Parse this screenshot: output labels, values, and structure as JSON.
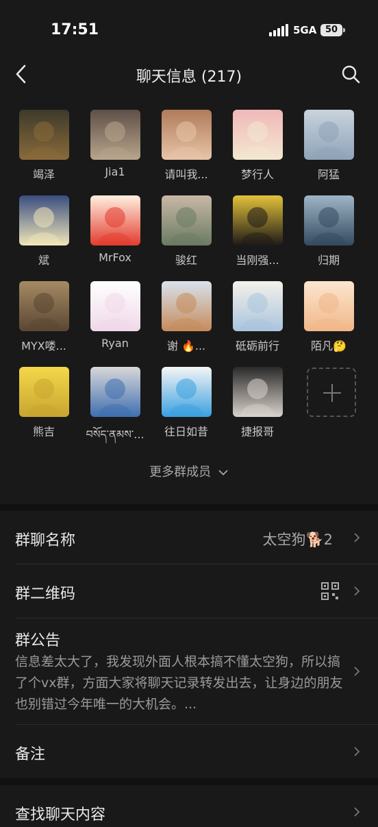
{
  "status_bar": {
    "time": "17:51",
    "network": "5GA",
    "battery": "50"
  },
  "nav": {
    "title": "聊天信息 (217)"
  },
  "members": [
    {
      "name": "竭泽"
    },
    {
      "name": "Jia1"
    },
    {
      "name": "请叫我..."
    },
    {
      "name": "梦行人"
    },
    {
      "name": "阿猛"
    },
    {
      "name": "斌"
    },
    {
      "name": "MrFox"
    },
    {
      "name": "骏红"
    },
    {
      "name": "当刚强..."
    },
    {
      "name": "归期"
    },
    {
      "name": "MYX喽..."
    },
    {
      "name": "Ryan"
    },
    {
      "name": "谢 🔥..."
    },
    {
      "name": "砥砺前行"
    },
    {
      "name": "陌凡🤔"
    },
    {
      "name": "熊吉"
    },
    {
      "name": "བསོད་ནམས་..."
    },
    {
      "name": "往日如昔"
    },
    {
      "name": "捷报哥"
    }
  ],
  "more_members": "更多群成员",
  "settings": {
    "group_name": {
      "label": "群聊名称",
      "value": "太空狗🐕2"
    },
    "qr_code": {
      "label": "群二维码"
    },
    "notice": {
      "label": "群公告",
      "text": "信息差太大了，我发现外面人根本搞不懂太空狗，所以搞了个vx群，方面大家将聊天记录转发出去，让身边的朋友也别错过今年唯一的大机会。..."
    },
    "remark": {
      "label": "备注"
    },
    "search_chat": {
      "label": "查找聊天内容"
    }
  }
}
